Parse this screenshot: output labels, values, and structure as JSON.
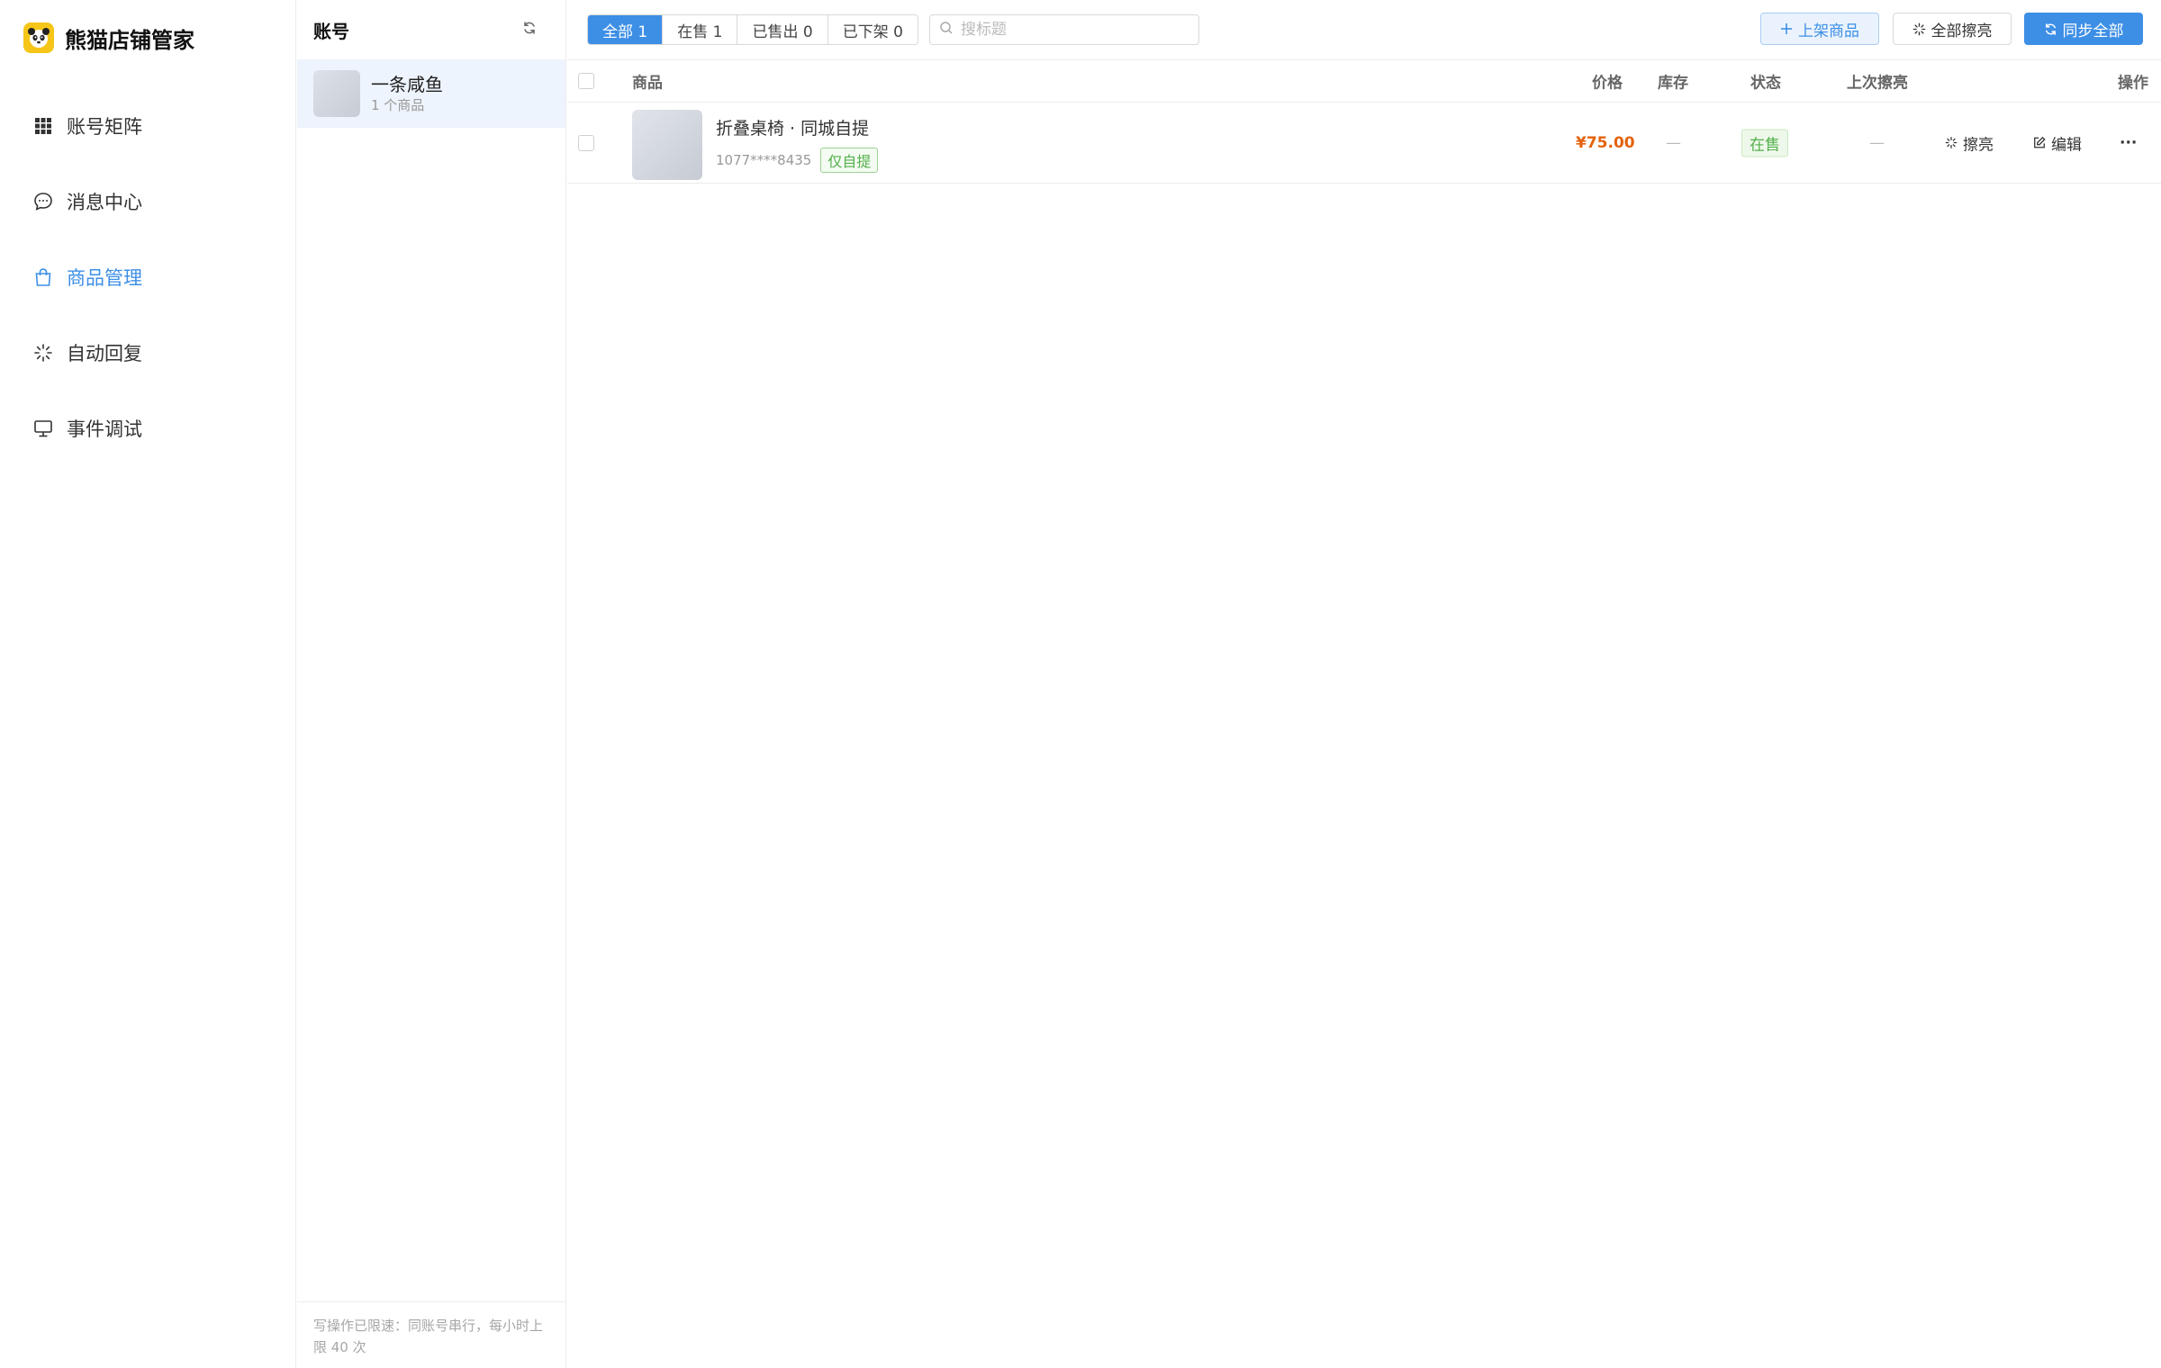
{
  "app": {
    "title": "熊猫店铺管家"
  },
  "sidebar": {
    "items": [
      {
        "label": "账号矩阵",
        "icon": "grid-icon",
        "active": false
      },
      {
        "label": "消息中心",
        "icon": "chat-bubble-icon",
        "active": false
      },
      {
        "label": "商品管理",
        "icon": "shopping-bag-icon",
        "active": true
      },
      {
        "label": "自动回复",
        "icon": "sparkle-icon",
        "active": false
      },
      {
        "label": "事件调试",
        "icon": "monitor-icon",
        "active": false
      }
    ]
  },
  "accounts": {
    "title": "账号",
    "refresh_icon": "refresh-icon",
    "items": [
      {
        "name": "一条咸鱼",
        "count": "1 个商品"
      }
    ],
    "footer": "写操作已限速：同账号串行，每小时上限 40 次"
  },
  "toolbar": {
    "tabs": [
      {
        "label": "全部 1",
        "active": true
      },
      {
        "label": "在售 1",
        "active": false
      },
      {
        "label": "已售出 0",
        "active": false
      },
      {
        "label": "已下架 0",
        "active": false
      }
    ],
    "search": {
      "placeholder": "搜标题",
      "value": ""
    },
    "list_button": "上架商品",
    "polish_all_button": "全部擦亮",
    "sync_all_button": "同步全部"
  },
  "table": {
    "headers": {
      "product": "商品",
      "price": "价格",
      "stock": "库存",
      "status": "状态",
      "last_polish": "上次擦亮",
      "actions": "操作"
    },
    "rows": [
      {
        "title": "折叠桌椅 · 同城自提",
        "id": "1077****8435",
        "tag": "仅自提",
        "price": "¥75.00",
        "stock": "—",
        "status": "在售",
        "last_polish": "—",
        "polish_label": "擦亮",
        "edit_label": "编辑",
        "more_label": "···"
      }
    ]
  },
  "colors": {
    "accent": "#3d8fe6",
    "price": "#e4620c",
    "success": "#52b04a",
    "brand_logo": "#f5c518"
  }
}
